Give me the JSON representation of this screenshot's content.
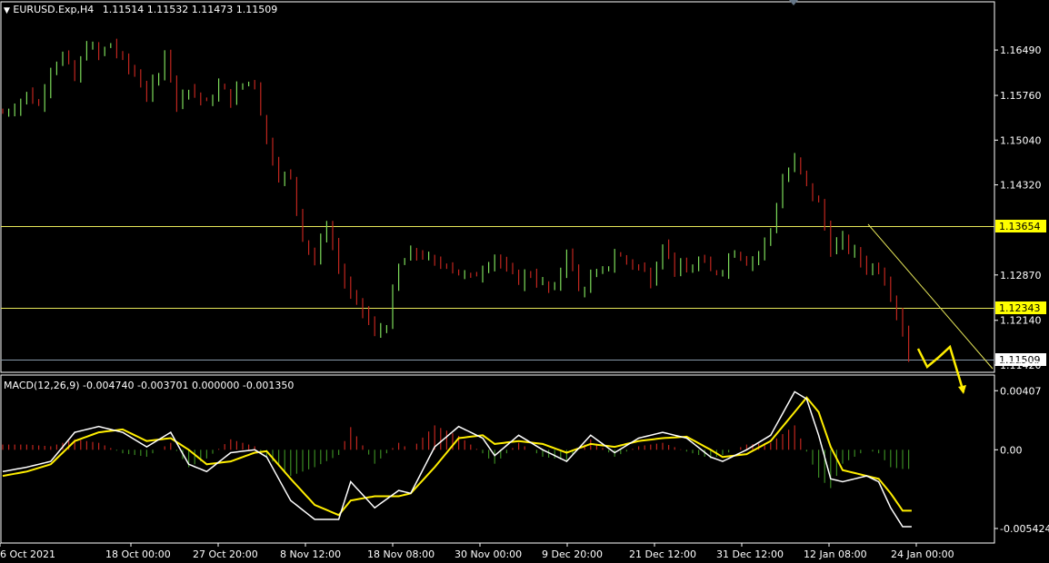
{
  "header": {
    "symbol": "EURUSD.Exp,H4",
    "ohlc": "1.11514 1.11532 1.11473 1.11509"
  },
  "macd_header": "MACD(12,26,9) -0.004740 -0.003701 0.000000 -0.001350",
  "colors": {
    "background": "#000000",
    "bull_candle": "#7ddc5a",
    "bear_candle": "#c0261f",
    "level_line": "#e8e85a",
    "level_label_bg": "#ffff00",
    "current_price_line": "#8899aa",
    "macd_line": "#ffffff",
    "signal_line": "#ffee00",
    "hist_pos": "#c0261f",
    "hist_neg": "#3a8a22",
    "arrow": "#ffee00",
    "frame": "#ffffff"
  },
  "chart_data": [
    {
      "type": "candlestick",
      "title": "EURUSD.Exp,H4",
      "ylim": [
        1.1142,
        1.1712
      ],
      "price_ticks": [
        "1.16490",
        "1.15760",
        "1.15040",
        "1.14320",
        "1.12870",
        "1.12140",
        "1.11420"
      ],
      "price_tick_values": [
        1.1649,
        1.1576,
        1.1504,
        1.1432,
        1.1287,
        1.1214,
        1.1142
      ],
      "date_labels": [
        "6 Oct 2021",
        "18 Oct 00:00",
        "27 Oct 20:00",
        "8 Nov 12:00",
        "18 Nov 08:00",
        "30 Nov 00:00",
        "9 Dec 20:00",
        "21 Dec 12:00",
        "31 Dec 12:00",
        "12 Jan 08:00",
        "24 Jan 00:00"
      ],
      "close_path": [
        [
          0,
          1.1548
        ],
        [
          2,
          1.156
        ],
        [
          4,
          1.1578
        ],
        [
          6,
          1.156
        ],
        [
          8,
          1.1622
        ],
        [
          10,
          1.164
        ],
        [
          12,
          1.16
        ],
        [
          14,
          1.166
        ],
        [
          16,
          1.164
        ],
        [
          18,
          1.166
        ],
        [
          20,
          1.163
        ],
        [
          22,
          1.161
        ],
        [
          24,
          1.158
        ],
        [
          26,
          1.16
        ],
        [
          27.5,
          1.168
        ],
        [
          28.5,
          1.154
        ],
        [
          30,
          1.159
        ],
        [
          32,
          1.158
        ],
        [
          34,
          1.156
        ],
        [
          36,
          1.159
        ],
        [
          38,
          1.157
        ],
        [
          40,
          1.1595
        ],
        [
          42,
          1.16
        ],
        [
          44,
          1.15
        ],
        [
          46,
          1.145
        ],
        [
          48,
          1.144
        ],
        [
          50,
          1.135
        ],
        [
          52,
          1.131
        ],
        [
          54,
          1.137
        ],
        [
          56,
          1.13
        ],
        [
          58,
          1.125
        ],
        [
          60,
          1.123
        ],
        [
          62,
          1.119
        ],
        [
          64,
          1.121
        ],
        [
          66,
          1.13
        ],
        [
          68,
          1.132
        ],
        [
          70,
          1.132
        ],
        [
          72,
          1.13
        ],
        [
          74,
          1.131
        ],
        [
          76,
          1.129
        ],
        [
          78,
          1.128
        ],
        [
          80,
          1.13
        ],
        [
          82,
          1.132
        ],
        [
          84,
          1.129
        ],
        [
          86,
          1.128
        ],
        [
          88,
          1.129
        ],
        [
          90,
          1.127
        ],
        [
          92,
          1.126
        ],
        [
          94,
          1.133
        ],
        [
          96,
          1.126
        ],
        [
          98,
          1.128
        ],
        [
          100,
          1.129
        ],
        [
          102,
          1.132
        ],
        [
          104,
          1.131
        ],
        [
          106,
          1.13
        ],
        [
          108,
          1.128
        ],
        [
          110,
          1.134
        ],
        [
          112,
          1.13
        ],
        [
          114,
          1.129
        ],
        [
          116,
          1.131
        ],
        [
          118,
          1.129
        ],
        [
          120,
          1.13
        ],
        [
          122,
          1.133
        ],
        [
          124,
          1.131
        ],
        [
          126,
          1.132
        ],
        [
          128,
          1.136
        ],
        [
          130,
          1.144
        ],
        [
          132,
          1.147
        ],
        [
          134,
          1.143
        ],
        [
          136,
          1.14
        ],
        [
          138,
          1.133
        ],
        [
          140,
          1.134
        ],
        [
          142,
          1.132
        ],
        [
          144,
          1.13
        ],
        [
          146,
          1.13
        ],
        [
          148,
          1.126
        ],
        [
          150,
          1.12
        ],
        [
          151,
          1.115
        ]
      ],
      "levels": [
        {
          "value": 1.13654,
          "label": "1.13654"
        },
        {
          "value": 1.12343,
          "label": "1.12343"
        }
      ],
      "current_price": {
        "value": 1.11509,
        "label": "1.11509"
      }
    },
    {
      "type": "line",
      "title": "MACD(12,26,9)",
      "ylim": [
        -0.0058,
        0.0044
      ],
      "y_ticks": [
        "0.00407",
        "0.00",
        "-0.005424"
      ],
      "y_tick_values": [
        0.00407,
        0.0,
        -0.005424
      ],
      "series": [
        {
          "name": "MACD",
          "points": [
            [
              0,
              -0.0015
            ],
            [
              4,
              -0.0012
            ],
            [
              8,
              -0.0008
            ],
            [
              12,
              0.0012
            ],
            [
              16,
              0.0016
            ],
            [
              20,
              0.0012
            ],
            [
              24,
              0.0002
            ],
            [
              28,
              0.0012
            ],
            [
              31,
              -0.001
            ],
            [
              34,
              -0.0015
            ],
            [
              38,
              -0.0002
            ],
            [
              42,
              0.0
            ],
            [
              44,
              -0.0005
            ],
            [
              48,
              -0.0035
            ],
            [
              52,
              -0.0048
            ],
            [
              56,
              -0.0048
            ],
            [
              58,
              -0.0022
            ],
            [
              62,
              -0.004
            ],
            [
              66,
              -0.0028
            ],
            [
              68,
              -0.003
            ],
            [
              72,
              0.0002
            ],
            [
              76,
              0.0016
            ],
            [
              80,
              0.0008
            ],
            [
              82,
              -0.0004
            ],
            [
              86,
              0.001
            ],
            [
              90,
              0.0
            ],
            [
              94,
              -0.0008
            ],
            [
              98,
              0.001
            ],
            [
              102,
              -0.0002
            ],
            [
              106,
              0.0008
            ],
            [
              110,
              0.0012
            ],
            [
              114,
              0.0008
            ],
            [
              118,
              -0.0005
            ],
            [
              120,
              -0.0008
            ],
            [
              124,
              0.0
            ],
            [
              128,
              0.001
            ],
            [
              132,
              0.004
            ],
            [
              134,
              0.0035
            ],
            [
              136,
              0.001
            ],
            [
              138,
              -0.002
            ],
            [
              140,
              -0.0022
            ],
            [
              144,
              -0.0018
            ],
            [
              146,
              -0.0022
            ],
            [
              148,
              -0.004
            ],
            [
              150,
              -0.0053
            ]
          ]
        },
        {
          "name": "Signal",
          "points": [
            [
              0,
              -0.0018
            ],
            [
              4,
              -0.0015
            ],
            [
              8,
              -0.001
            ],
            [
              12,
              0.0006
            ],
            [
              16,
              0.0012
            ],
            [
              20,
              0.0014
            ],
            [
              24,
              0.0006
            ],
            [
              28,
              0.0008
            ],
            [
              31,
              0.0
            ],
            [
              34,
              -0.001
            ],
            [
              38,
              -0.0008
            ],
            [
              42,
              -0.0002
            ],
            [
              44,
              -0.0001
            ],
            [
              48,
              -0.002
            ],
            [
              52,
              -0.0038
            ],
            [
              56,
              -0.0045
            ],
            [
              58,
              -0.0035
            ],
            [
              62,
              -0.0032
            ],
            [
              66,
              -0.0032
            ],
            [
              68,
              -0.003
            ],
            [
              72,
              -0.0012
            ],
            [
              76,
              0.0008
            ],
            [
              80,
              0.001
            ],
            [
              82,
              0.0004
            ],
            [
              86,
              0.0006
            ],
            [
              90,
              0.0004
            ],
            [
              94,
              -0.0002
            ],
            [
              98,
              0.0004
            ],
            [
              102,
              0.0002
            ],
            [
              106,
              0.0006
            ],
            [
              110,
              0.0008
            ],
            [
              114,
              0.0009
            ],
            [
              118,
              0.0
            ],
            [
              120,
              -0.0005
            ],
            [
              124,
              -0.0003
            ],
            [
              128,
              0.0006
            ],
            [
              132,
              0.0026
            ],
            [
              134,
              0.0036
            ],
            [
              136,
              0.0026
            ],
            [
              138,
              0.0002
            ],
            [
              140,
              -0.0014
            ],
            [
              144,
              -0.0018
            ],
            [
              146,
              -0.002
            ],
            [
              148,
              -0.003
            ],
            [
              150,
              -0.0042
            ]
          ]
        }
      ]
    }
  ]
}
